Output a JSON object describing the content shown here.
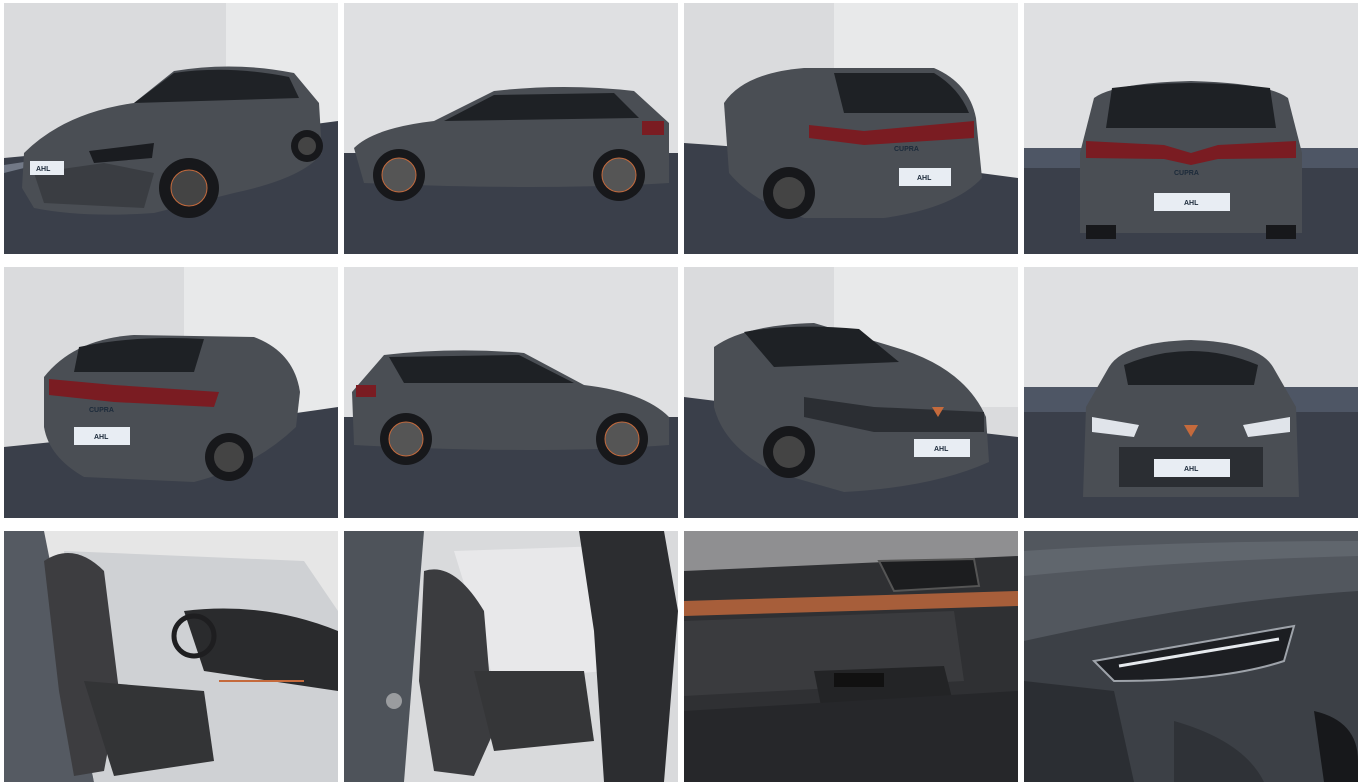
{
  "gallery": {
    "photos": [
      {
        "view": "front-left three-quarter exterior",
        "plate": "AHL"
      },
      {
        "view": "left side profile exterior"
      },
      {
        "view": "rear-left three-quarter exterior",
        "plate": "AHL",
        "badge": "CUPRA"
      },
      {
        "view": "rear exterior",
        "plate": "AHL",
        "badge": "CUPRA"
      },
      {
        "view": "rear-left three-quarter exterior raised",
        "plate": "AHL",
        "badge": "CUPRA"
      },
      {
        "view": "right side profile exterior"
      },
      {
        "view": "front-right three-quarter exterior",
        "plate": "AHL"
      },
      {
        "view": "front exterior",
        "plate": "AHL"
      },
      {
        "view": "front seats interior"
      },
      {
        "view": "rear seats interior"
      },
      {
        "view": "door panel interior detail"
      },
      {
        "view": "headlight detail exterior"
      }
    ]
  },
  "colors": {
    "car_body": "#4a4e54",
    "car_dark": "#2b2e33",
    "studio_wall": "#dadbdd",
    "floor": "#3a3f4a",
    "accent_copper": "#c56a3c",
    "tail_light": "#7a1c22"
  }
}
